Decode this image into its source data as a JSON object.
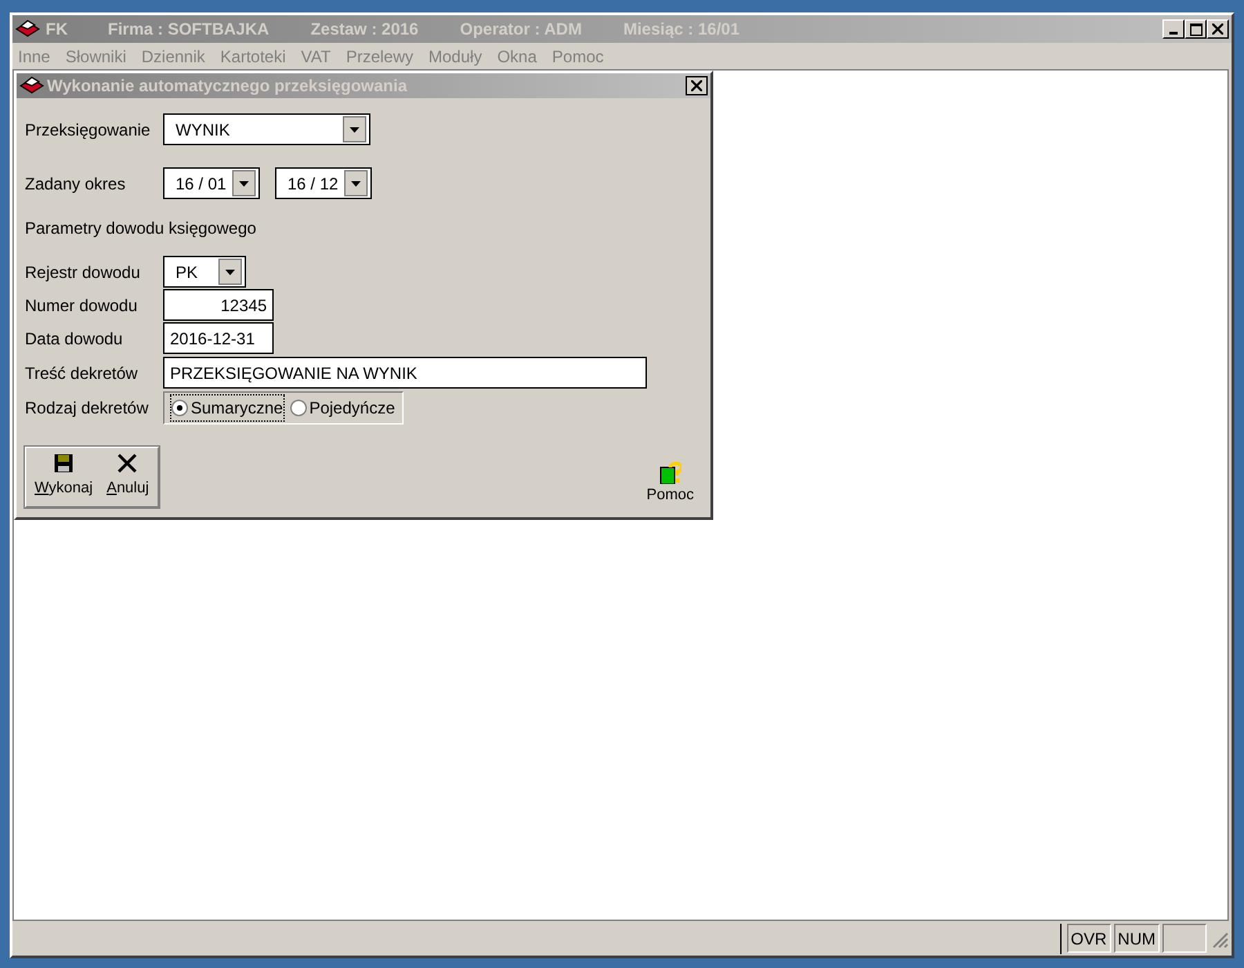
{
  "window": {
    "title_parts": [
      "FK",
      "Firma : SOFTBAJKA",
      "Zestaw : 2016",
      "Operator : ADM",
      "Miesiąc : 16/01"
    ]
  },
  "menu": [
    {
      "label": "Inne",
      "disabled": true
    },
    {
      "label": "Słowniki",
      "disabled": true
    },
    {
      "label": "Dziennik",
      "disabled": true
    },
    {
      "label": "Kartoteki",
      "disabled": true
    },
    {
      "label": "VAT",
      "disabled": true
    },
    {
      "label": "Przelewy",
      "disabled": true
    },
    {
      "label": "Moduły",
      "disabled": true
    },
    {
      "label": "Okna",
      "disabled": true
    },
    {
      "label": "Pomoc",
      "disabled": true
    }
  ],
  "dialog": {
    "title": "Wykonanie automatycznego przeksięgowania",
    "przeksiegowanie": {
      "label": "Przeksięgowanie",
      "value": "WYNIK"
    },
    "okres": {
      "label": "Zadany okres",
      "from": "16 / 01",
      "to": "16 / 12"
    },
    "section": "Parametry dowodu księgowego",
    "rejestr": {
      "label": "Rejestr dowodu",
      "value": "PK"
    },
    "numer": {
      "label": "Numer dowodu",
      "value": "12345"
    },
    "data": {
      "label": "Data dowodu",
      "value": "2016-12-31"
    },
    "tresc": {
      "label": "Treść dekretów",
      "value": "PRZEKSIĘGOWANIE NA WYNIK"
    },
    "rodzaj": {
      "label": "Rodzaj dekretów",
      "options": [
        {
          "label": "Sumaryczne",
          "selected": true
        },
        {
          "label": "Pojedyńcze",
          "selected": false
        }
      ]
    },
    "buttons": [
      {
        "kind": "save",
        "label": "Wykonaj"
      },
      {
        "kind": "cancel",
        "label": "Anuluj"
      }
    ],
    "help": "Pomoc"
  },
  "status_bar": [
    "OVR",
    "NUM"
  ]
}
